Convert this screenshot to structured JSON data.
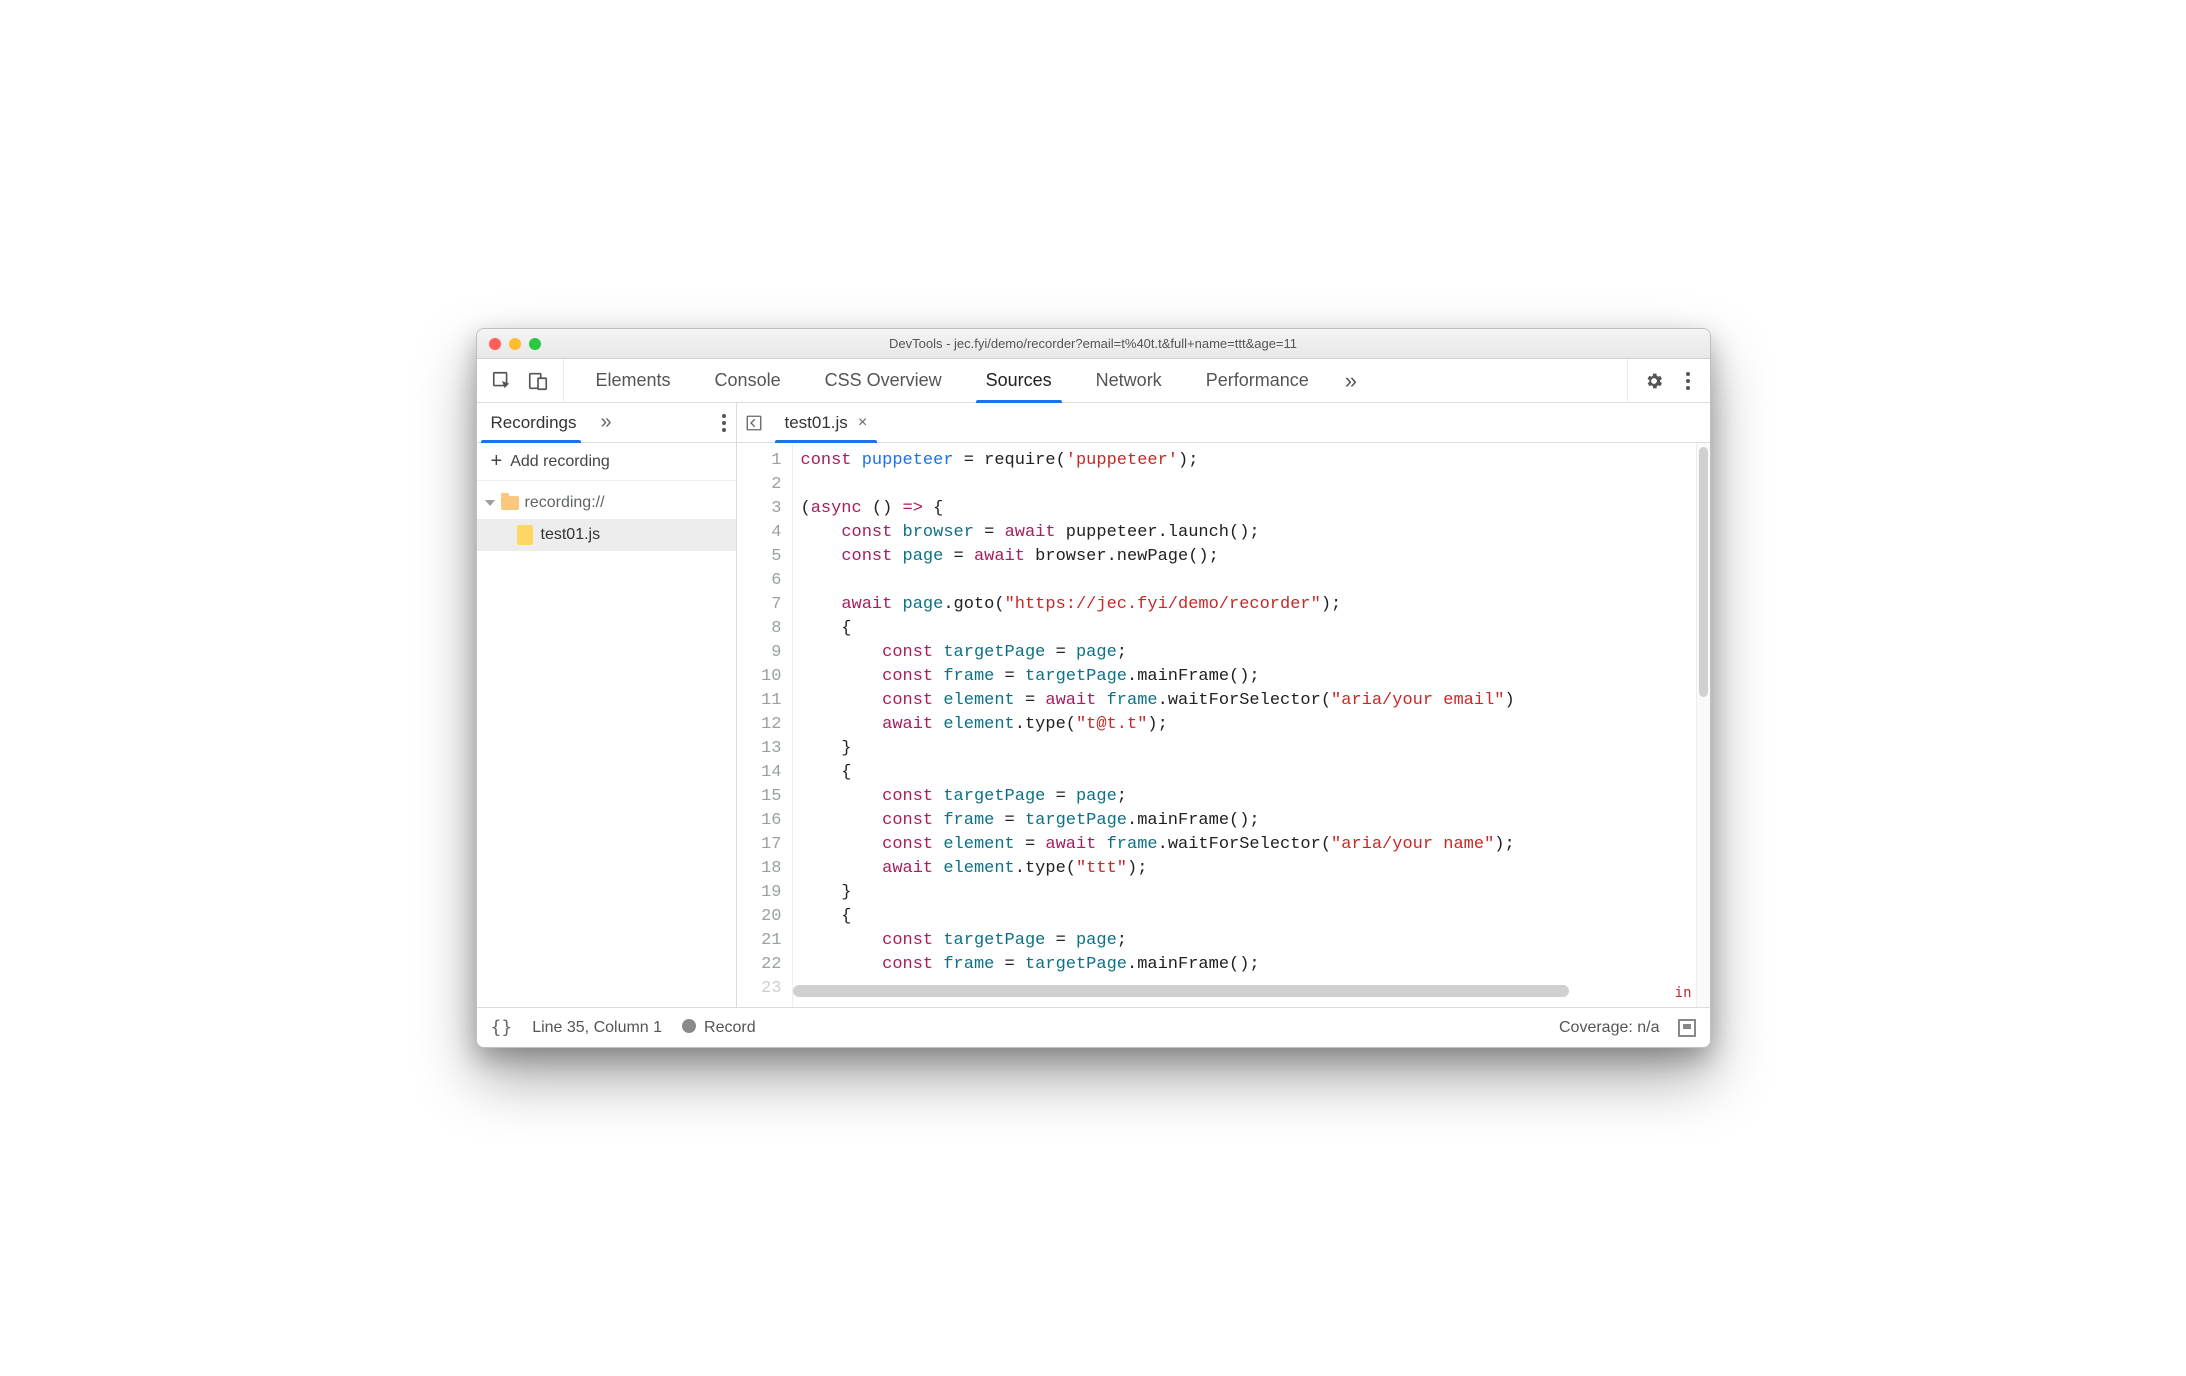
{
  "window": {
    "title": "DevTools - jec.fyi/demo/recorder?email=t%40t.t&full+name=ttt&age=11"
  },
  "toolbar": {
    "tabs": [
      "Elements",
      "Console",
      "CSS Overview",
      "Sources",
      "Network",
      "Performance"
    ],
    "active_index": 3,
    "more_glyph": "»"
  },
  "sidebar_header": {
    "tab": "Recordings",
    "more_glyph": "»",
    "add_label": "Add recording",
    "plus_glyph": "+"
  },
  "tree": {
    "root_label": "recording://",
    "file": "test01.js"
  },
  "editor": {
    "tab_filename": "test01.js",
    "close_glyph": "×",
    "line_start": 1,
    "lines": [
      [
        [
          "kw",
          "const "
        ],
        [
          "idp",
          "puppeteer"
        ],
        [
          "punct",
          " = "
        ],
        [
          "",
          "require("
        ],
        [
          "str",
          "'puppeteer'"
        ],
        [
          "punct",
          ");"
        ]
      ],
      [
        [
          "",
          ""
        ]
      ],
      [
        [
          "punct",
          "("
        ],
        [
          "kw",
          "async"
        ],
        [
          "punct",
          " () "
        ],
        [
          "arrow-op",
          "=>"
        ],
        [
          "punct",
          " {"
        ]
      ],
      [
        [
          "",
          "    "
        ],
        [
          "kw",
          "const "
        ],
        [
          "id",
          "browser"
        ],
        [
          "punct",
          " = "
        ],
        [
          "kw",
          "await"
        ],
        [
          "",
          ""
        ],
        [
          "",
          ""
        ],
        [
          "",
          ""
        ],
        [
          "",
          ""
        ],
        [
          "",
          ""
        ],
        [
          "",
          ""
        ],
        [
          "",
          ""
        ],
        [
          "",
          ""
        ],
        [
          "",
          ""
        ],
        [
          "",
          ""
        ],
        [
          "",
          ""
        ],
        [
          "",
          ""
        ],
        [
          "",
          ""
        ],
        [
          "",
          ""
        ],
        [
          "",
          ""
        ],
        [
          "",
          ""
        ],
        [
          "",
          ""
        ],
        [
          "",
          ""
        ],
        [
          "",
          ""
        ],
        [
          "",
          ""
        ],
        [
          "",
          ""
        ],
        [
          "",
          ""
        ],
        [
          "",
          ""
        ],
        [
          "",
          ""
        ],
        [
          "",
          ""
        ],
        [
          "",
          ""
        ],
        [
          "",
          ""
        ],
        [
          "",
          ""
        ],
        [
          "",
          ""
        ],
        [
          "",
          ""
        ],
        [
          "",
          ""
        ],
        [
          "",
          ""
        ],
        [
          "",
          ""
        ],
        [
          "",
          ""
        ],
        [
          "",
          ""
        ],
        [
          "",
          ""
        ],
        [
          "",
          ""
        ],
        [
          "",
          ""
        ],
        [
          "",
          ""
        ],
        [
          "",
          ""
        ],
        [
          "",
          ""
        ],
        [
          "",
          ""
        ],
        [
          "",
          ""
        ],
        [
          "",
          ""
        ],
        [
          "",
          ""
        ],
        [
          "",
          ""
        ],
        [
          "",
          ""
        ],
        [
          "",
          ""
        ],
        [
          "",
          ""
        ],
        [
          "",
          ""
        ],
        [
          "",
          ""
        ],
        [
          "",
          ""
        ],
        [
          "",
          ""
        ],
        [
          "",
          ""
        ],
        [
          "",
          ""
        ],
        [
          "",
          ""
        ],
        [
          "",
          ""
        ],
        [
          "",
          ""
        ],
        [
          "",
          ""
        ],
        [
          "",
          ""
        ],
        [
          "",
          ""
        ],
        [
          "",
          ""
        ],
        [
          "",
          ""
        ],
        [
          "",
          ""
        ],
        [
          "",
          ""
        ],
        [
          "",
          ""
        ],
        [
          "",
          ""
        ],
        [
          "",
          ""
        ],
        [
          "",
          ""
        ],
        [
          "",
          ""
        ],
        [
          "",
          ""
        ],
        [
          "",
          ""
        ],
        [
          "",
          ""
        ],
        [
          "",
          ""
        ],
        [
          "",
          ""
        ],
        [
          "",
          ""
        ],
        [
          "",
          ""
        ],
        [
          "",
          ""
        ],
        [
          "",
          ""
        ],
        [
          "",
          ""
        ],
        [
          "",
          ""
        ],
        [
          "",
          ""
        ],
        [
          "",
          ""
        ],
        [
          "",
          ""
        ],
        [
          "",
          ""
        ],
        [
          "",
          ""
        ],
        [
          "",
          ""
        ],
        [
          "",
          ""
        ],
        [
          "",
          ""
        ],
        [
          "",
          ""
        ],
        [
          "",
          ""
        ],
        [
          "",
          ""
        ],
        [
          "",
          ""
        ],
        [
          "",
          ""
        ],
        [
          "",
          ""
        ],
        [
          "",
          ""
        ],
        [
          "",
          ""
        ],
        [
          "",
          ""
        ],
        [
          "",
          ""
        ],
        [
          "",
          ""
        ],
        [
          "",
          ""
        ],
        [
          "",
          ""
        ],
        [
          "",
          ""
        ],
        [
          "",
          ""
        ],
        [
          "",
          ""
        ],
        [
          "",
          ""
        ],
        [
          "",
          ""
        ],
        [
          "",
          ""
        ],
        [
          "",
          ""
        ]
      ],
      [
        [
          "",
          "    "
        ],
        [
          "kw",
          "const "
        ],
        [
          "id",
          "page"
        ],
        [
          "punct",
          " = "
        ],
        [
          "kw",
          "await"
        ],
        [
          "",
          ""
        ],
        [
          "",
          ""
        ]
      ],
      [
        [
          "",
          ""
        ]
      ],
      [
        [
          "",
          "    "
        ],
        [
          "kw",
          "await"
        ],
        [
          "",
          ""
        ],
        [
          "id",
          " page"
        ],
        [
          "punct",
          "."
        ],
        [
          "",
          "goto("
        ],
        [
          "str",
          "\"https://jec.fyi/demo/recorder\""
        ],
        [
          "punct",
          ");"
        ]
      ],
      [
        [
          "",
          "    {"
        ]
      ],
      [
        [
          "",
          "        "
        ],
        [
          "kw",
          "const "
        ],
        [
          "id",
          "targetPage"
        ],
        [
          "punct",
          " = "
        ],
        [
          "id",
          "page"
        ],
        [
          "punct",
          ";"
        ]
      ],
      [
        [
          "",
          "        "
        ],
        [
          "kw",
          "const "
        ],
        [
          "id",
          "frame"
        ],
        [
          "punct",
          " = "
        ],
        [
          "id",
          "targetPage"
        ],
        [
          "punct",
          "."
        ],
        [
          "",
          "mainFrame();"
        ]
      ],
      [
        [
          "",
          "        "
        ],
        [
          "kw",
          "const "
        ],
        [
          "id",
          "element"
        ],
        [
          "punct",
          " = "
        ],
        [
          "kw",
          "await"
        ],
        [
          "id",
          " frame"
        ],
        [
          "punct",
          "."
        ],
        [
          "",
          "waitForSelector("
        ],
        [
          "str",
          "\"aria/your email\""
        ],
        [
          "punct",
          ")"
        ]
      ],
      [
        [
          "",
          "        "
        ],
        [
          "kw",
          "await"
        ],
        [
          "id",
          " element"
        ],
        [
          "punct",
          "."
        ],
        [
          "",
          "type("
        ],
        [
          "str",
          "\"t@t.t\""
        ],
        [
          "punct",
          ");"
        ]
      ],
      [
        [
          "",
          "    }"
        ]
      ],
      [
        [
          "",
          "    {"
        ]
      ],
      [
        [
          "",
          "        "
        ],
        [
          "kw",
          "const "
        ],
        [
          "id",
          "targetPage"
        ],
        [
          "punct",
          " = "
        ],
        [
          "id",
          "page"
        ],
        [
          "punct",
          ";"
        ]
      ],
      [
        [
          "",
          "        "
        ],
        [
          "kw",
          "const "
        ],
        [
          "id",
          "frame"
        ],
        [
          "punct",
          " = "
        ],
        [
          "id",
          "targetPage"
        ],
        [
          "punct",
          "."
        ],
        [
          "",
          "mainFrame();"
        ]
      ],
      [
        [
          "",
          "        "
        ],
        [
          "kw",
          "const "
        ],
        [
          "id",
          "element"
        ],
        [
          "punct",
          " = "
        ],
        [
          "kw",
          "await"
        ],
        [
          "id",
          " frame"
        ],
        [
          "punct",
          "."
        ],
        [
          "",
          "waitForSelector("
        ],
        [
          "str",
          "\"aria/your name\""
        ],
        [
          "punct",
          ");"
        ]
      ],
      [
        [
          "",
          "        "
        ],
        [
          "kw",
          "await"
        ],
        [
          "id",
          " element"
        ],
        [
          "punct",
          "."
        ],
        [
          "",
          "type("
        ],
        [
          "str",
          "\"ttt\""
        ],
        [
          "punct",
          ");"
        ]
      ],
      [
        [
          "",
          "    }"
        ]
      ],
      [
        [
          "",
          "    {"
        ]
      ],
      [
        [
          "",
          "        "
        ],
        [
          "kw",
          "const "
        ],
        [
          "id",
          "targetPage"
        ],
        [
          "punct",
          " = "
        ],
        [
          "id",
          "page"
        ],
        [
          "punct",
          ";"
        ]
      ],
      [
        [
          "",
          "        "
        ],
        [
          "kw",
          "const "
        ],
        [
          "id",
          "frame"
        ],
        [
          "punct",
          " = "
        ],
        [
          "id",
          "targetPage"
        ],
        [
          "punct",
          "."
        ],
        [
          "",
          "mainFrame();"
        ]
      ]
    ],
    "line4_extra": " puppeteer.launch();",
    "line5_extra": " browser.newPage();",
    "overflow_hint": "in"
  },
  "status": {
    "braces": "{}",
    "cursor": "Line 35, Column 1",
    "record_label": "Record",
    "coverage": "Coverage: n/a"
  }
}
